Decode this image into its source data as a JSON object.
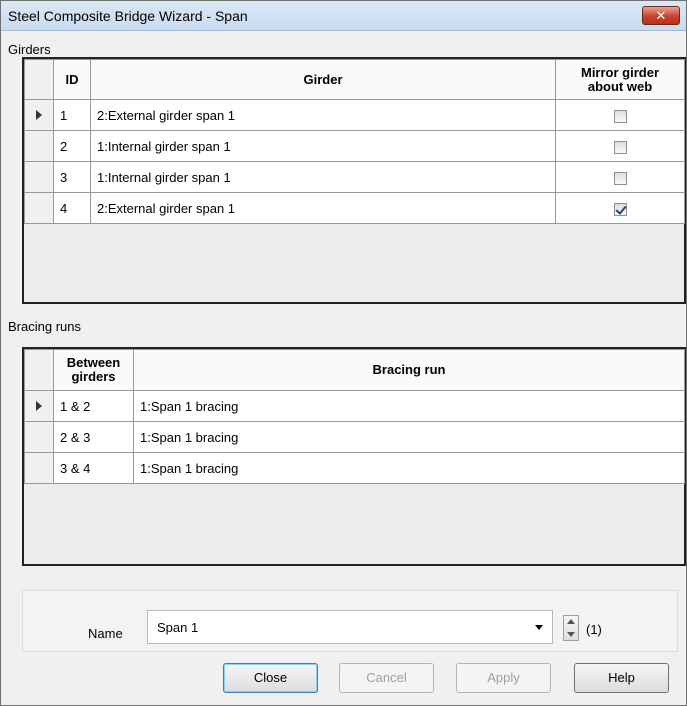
{
  "window": {
    "title": "Steel Composite Bridge Wizard - Span",
    "close_glyph": "✕"
  },
  "girders": {
    "section_label": "Girders",
    "columns": {
      "id": "ID",
      "girder": "Girder",
      "mirror": "Mirror girder about web"
    },
    "rows": [
      {
        "id": "1",
        "girder": "2:External girder span 1",
        "mirror": false,
        "current": true
      },
      {
        "id": "2",
        "girder": "1:Internal girder span 1",
        "mirror": false,
        "current": false
      },
      {
        "id": "3",
        "girder": "1:Internal girder span 1",
        "mirror": false,
        "current": false
      },
      {
        "id": "4",
        "girder": "2:External girder span 1",
        "mirror": true,
        "current": false
      }
    ]
  },
  "bracing": {
    "section_label": "Bracing runs",
    "columns": {
      "between": "Between girders",
      "run": "Bracing run"
    },
    "rows": [
      {
        "between": "1 & 2",
        "run": "1:Span 1 bracing",
        "current": true
      },
      {
        "between": "2 & 3",
        "run": "1:Span 1 bracing",
        "current": false
      },
      {
        "between": "3 & 4",
        "run": "1:Span 1 bracing",
        "current": false
      }
    ]
  },
  "name": {
    "label": "Name",
    "value": "Span 1",
    "count": "(1)"
  },
  "buttons": {
    "close": "Close",
    "cancel": "Cancel",
    "apply": "Apply",
    "help": "Help"
  },
  "colors": {
    "title_bg": "#c8dbf0",
    "close_red": "#c8432c",
    "check_blue": "#2a3f8f"
  }
}
